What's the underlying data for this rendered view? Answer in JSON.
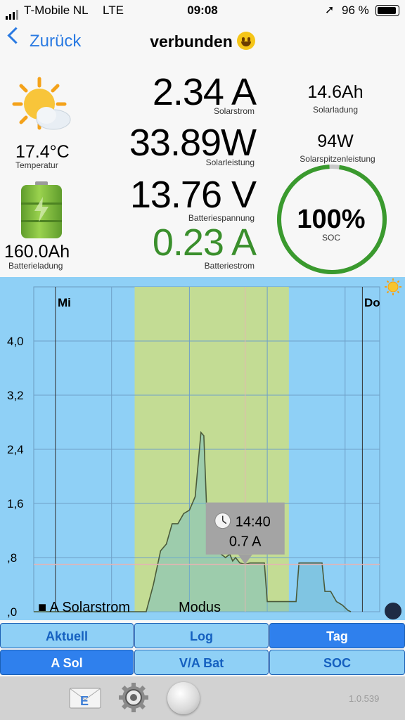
{
  "status_bar": {
    "carrier": "T-Mobile NL",
    "network": "LTE",
    "time": "09:08",
    "battery": "96 %"
  },
  "nav": {
    "back_label": "Zurück",
    "title": "verbunden"
  },
  "weather": {
    "temperature": "17.4°C",
    "temperature_label": "Temperatur",
    "icon": "sun-cloud-icon"
  },
  "battery": {
    "charge": "160.0Ah",
    "charge_label": "Batterieladung",
    "icon": "battery-charging-icon"
  },
  "readings": {
    "solar_current": "2.34 A",
    "solar_current_label": "Solarstrom",
    "solar_power": "33.89W",
    "solar_power_label": "Solarleistung",
    "battery_voltage": "13.76 V",
    "battery_voltage_label": "Batteriespannung",
    "battery_current": "0.23 A",
    "battery_current_label": "Batteriestrom",
    "battery_current_color": "#3a8f2c"
  },
  "right": {
    "solar_charge": "14.6Ah",
    "solar_charge_label": "Solarladung",
    "peak_power": "94W",
    "peak_power_label": "Solarspitzenleistung",
    "soc_value": "100%",
    "soc_label": "SOC",
    "soc_percent": 97,
    "ring_color": "#3a9a2e"
  },
  "chart_data": {
    "type": "line",
    "day_labels": [
      "Mi",
      "Do"
    ],
    "y_ticks": [
      "4,0",
      "3,2",
      "2,4",
      "1,6",
      ",8",
      ",0"
    ],
    "ylim": [
      0,
      4.8
    ],
    "xlim": [
      0,
      24
    ],
    "x": [
      0,
      7.8,
      8.3,
      8.8,
      9.2,
      9.6,
      10.0,
      10.4,
      10.8,
      11.2,
      11.6,
      11.8,
      12.0,
      12.2,
      12.4,
      12.6,
      12.8,
      13.0,
      13.3,
      13.6,
      13.8,
      14.0,
      14.3,
      14.67,
      15.0,
      15.5,
      16.0,
      16.2,
      16.4,
      17.0,
      17.6,
      18.2,
      18.4,
      18.6,
      19.2,
      19.8,
      20.0,
      20.2,
      20.6,
      21.0,
      21.4,
      21.8,
      22.0
    ],
    "y": [
      0,
      0,
      0.4,
      0.9,
      1.0,
      1.3,
      1.3,
      1.45,
      1.5,
      1.7,
      2.65,
      2.6,
      1.5,
      0.9,
      0.95,
      1.0,
      0.9,
      0.85,
      0.8,
      0.85,
      0.75,
      0.8,
      0.72,
      0.7,
      0.72,
      0.72,
      0.72,
      0.15,
      0.15,
      0.15,
      0.15,
      0.15,
      0.72,
      0.72,
      0.72,
      0.72,
      0.72,
      0.3,
      0.3,
      0.15,
      0.1,
      0.02,
      0
    ],
    "daylight_start": 7.0,
    "daylight_end": 17.7,
    "tooltip_time": "14:40",
    "tooltip_value": "0.7 A",
    "tooltip_x": 14.67,
    "tooltip_y": 0.7,
    "legend": "■ A Solarstrom",
    "mode_label": "Modus",
    "line_color": "#4a5a3a",
    "fill_color": "#6fb7c9"
  },
  "tabs_row1": [
    {
      "label": "Aktuell",
      "active": false
    },
    {
      "label": "Log",
      "active": false
    },
    {
      "label": "Tag",
      "active": true
    }
  ],
  "tabs_row2": [
    {
      "label": "A Sol",
      "active": true
    },
    {
      "label": "V/A Bat",
      "active": false
    },
    {
      "label": "SOC",
      "active": false
    }
  ],
  "footer": {
    "version": "1.0.539",
    "mail_icon": "mail-icon",
    "settings_icon": "gear-icon",
    "record_icon": "round-button-icon"
  }
}
